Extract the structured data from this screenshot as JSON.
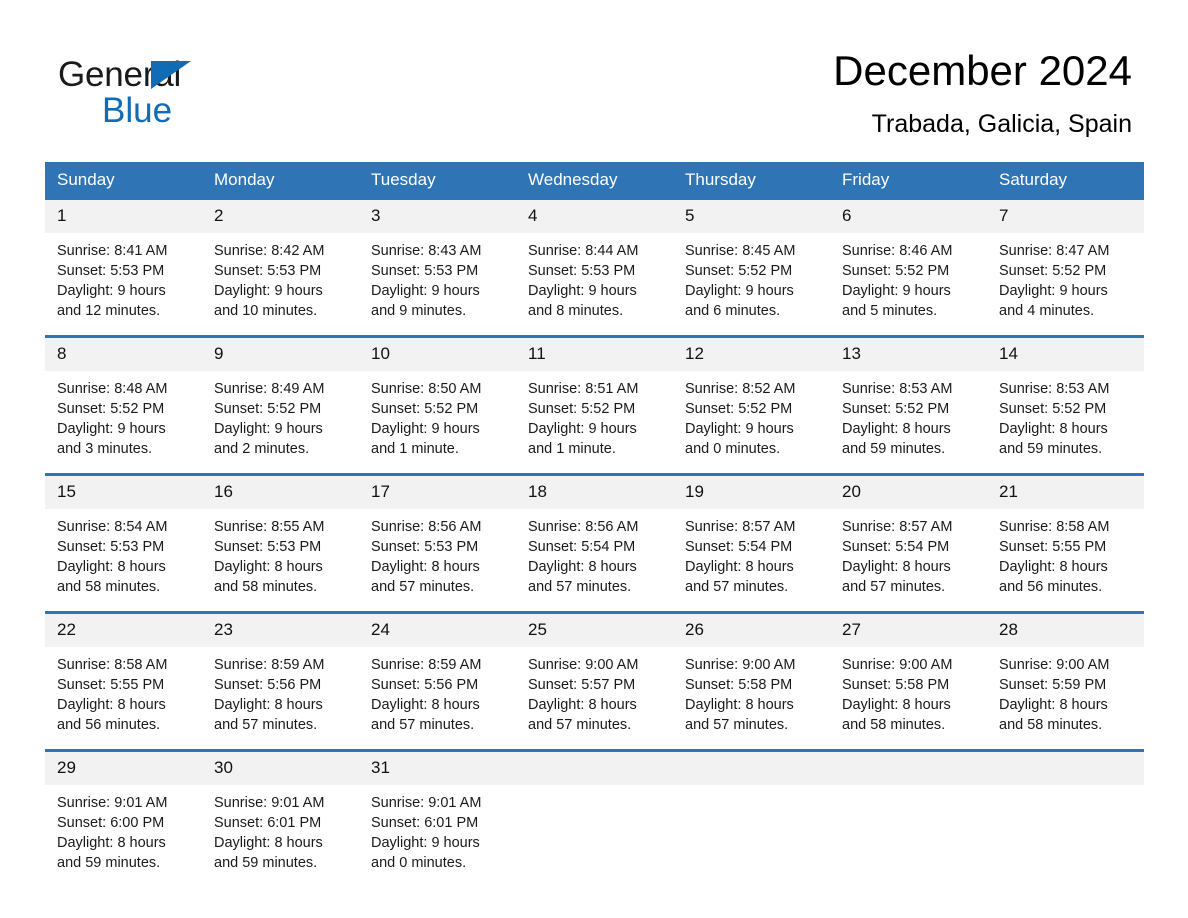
{
  "brand": {
    "name_part1": "General",
    "name_part2": "Blue",
    "accent_color": "#0f6cb5",
    "triangle_icon": "triangle-icon"
  },
  "header": {
    "month_title": "December 2024",
    "location": "Trabada, Galicia, Spain"
  },
  "theme": {
    "header_blue": "#2f75b5",
    "daynum_band": "#f2f2f2",
    "text": "#1a1a1a"
  },
  "calendar": {
    "weekday_headers": [
      "Sunday",
      "Monday",
      "Tuesday",
      "Wednesday",
      "Thursday",
      "Friday",
      "Saturday"
    ],
    "weeks": [
      {
        "days": [
          {
            "num": "1",
            "sunrise": "Sunrise: 8:41 AM",
            "sunset": "Sunset: 5:53 PM",
            "daylight1": "Daylight: 9 hours",
            "daylight2": "and 12 minutes."
          },
          {
            "num": "2",
            "sunrise": "Sunrise: 8:42 AM",
            "sunset": "Sunset: 5:53 PM",
            "daylight1": "Daylight: 9 hours",
            "daylight2": "and 10 minutes."
          },
          {
            "num": "3",
            "sunrise": "Sunrise: 8:43 AM",
            "sunset": "Sunset: 5:53 PM",
            "daylight1": "Daylight: 9 hours",
            "daylight2": "and 9 minutes."
          },
          {
            "num": "4",
            "sunrise": "Sunrise: 8:44 AM",
            "sunset": "Sunset: 5:53 PM",
            "daylight1": "Daylight: 9 hours",
            "daylight2": "and 8 minutes."
          },
          {
            "num": "5",
            "sunrise": "Sunrise: 8:45 AM",
            "sunset": "Sunset: 5:52 PM",
            "daylight1": "Daylight: 9 hours",
            "daylight2": "and 6 minutes."
          },
          {
            "num": "6",
            "sunrise": "Sunrise: 8:46 AM",
            "sunset": "Sunset: 5:52 PM",
            "daylight1": "Daylight: 9 hours",
            "daylight2": "and 5 minutes."
          },
          {
            "num": "7",
            "sunrise": "Sunrise: 8:47 AM",
            "sunset": "Sunset: 5:52 PM",
            "daylight1": "Daylight: 9 hours",
            "daylight2": "and 4 minutes."
          }
        ]
      },
      {
        "days": [
          {
            "num": "8",
            "sunrise": "Sunrise: 8:48 AM",
            "sunset": "Sunset: 5:52 PM",
            "daylight1": "Daylight: 9 hours",
            "daylight2": "and 3 minutes."
          },
          {
            "num": "9",
            "sunrise": "Sunrise: 8:49 AM",
            "sunset": "Sunset: 5:52 PM",
            "daylight1": "Daylight: 9 hours",
            "daylight2": "and 2 minutes."
          },
          {
            "num": "10",
            "sunrise": "Sunrise: 8:50 AM",
            "sunset": "Sunset: 5:52 PM",
            "daylight1": "Daylight: 9 hours",
            "daylight2": "and 1 minute."
          },
          {
            "num": "11",
            "sunrise": "Sunrise: 8:51 AM",
            "sunset": "Sunset: 5:52 PM",
            "daylight1": "Daylight: 9 hours",
            "daylight2": "and 1 minute."
          },
          {
            "num": "12",
            "sunrise": "Sunrise: 8:52 AM",
            "sunset": "Sunset: 5:52 PM",
            "daylight1": "Daylight: 9 hours",
            "daylight2": "and 0 minutes."
          },
          {
            "num": "13",
            "sunrise": "Sunrise: 8:53 AM",
            "sunset": "Sunset: 5:52 PM",
            "daylight1": "Daylight: 8 hours",
            "daylight2": "and 59 minutes."
          },
          {
            "num": "14",
            "sunrise": "Sunrise: 8:53 AM",
            "sunset": "Sunset: 5:52 PM",
            "daylight1": "Daylight: 8 hours",
            "daylight2": "and 59 minutes."
          }
        ]
      },
      {
        "days": [
          {
            "num": "15",
            "sunrise": "Sunrise: 8:54 AM",
            "sunset": "Sunset: 5:53 PM",
            "daylight1": "Daylight: 8 hours",
            "daylight2": "and 58 minutes."
          },
          {
            "num": "16",
            "sunrise": "Sunrise: 8:55 AM",
            "sunset": "Sunset: 5:53 PM",
            "daylight1": "Daylight: 8 hours",
            "daylight2": "and 58 minutes."
          },
          {
            "num": "17",
            "sunrise": "Sunrise: 8:56 AM",
            "sunset": "Sunset: 5:53 PM",
            "daylight1": "Daylight: 8 hours",
            "daylight2": "and 57 minutes."
          },
          {
            "num": "18",
            "sunrise": "Sunrise: 8:56 AM",
            "sunset": "Sunset: 5:54 PM",
            "daylight1": "Daylight: 8 hours",
            "daylight2": "and 57 minutes."
          },
          {
            "num": "19",
            "sunrise": "Sunrise: 8:57 AM",
            "sunset": "Sunset: 5:54 PM",
            "daylight1": "Daylight: 8 hours",
            "daylight2": "and 57 minutes."
          },
          {
            "num": "20",
            "sunrise": "Sunrise: 8:57 AM",
            "sunset": "Sunset: 5:54 PM",
            "daylight1": "Daylight: 8 hours",
            "daylight2": "and 57 minutes."
          },
          {
            "num": "21",
            "sunrise": "Sunrise: 8:58 AM",
            "sunset": "Sunset: 5:55 PM",
            "daylight1": "Daylight: 8 hours",
            "daylight2": "and 56 minutes."
          }
        ]
      },
      {
        "days": [
          {
            "num": "22",
            "sunrise": "Sunrise: 8:58 AM",
            "sunset": "Sunset: 5:55 PM",
            "daylight1": "Daylight: 8 hours",
            "daylight2": "and 56 minutes."
          },
          {
            "num": "23",
            "sunrise": "Sunrise: 8:59 AM",
            "sunset": "Sunset: 5:56 PM",
            "daylight1": "Daylight: 8 hours",
            "daylight2": "and 57 minutes."
          },
          {
            "num": "24",
            "sunrise": "Sunrise: 8:59 AM",
            "sunset": "Sunset: 5:56 PM",
            "daylight1": "Daylight: 8 hours",
            "daylight2": "and 57 minutes."
          },
          {
            "num": "25",
            "sunrise": "Sunrise: 9:00 AM",
            "sunset": "Sunset: 5:57 PM",
            "daylight1": "Daylight: 8 hours",
            "daylight2": "and 57 minutes."
          },
          {
            "num": "26",
            "sunrise": "Sunrise: 9:00 AM",
            "sunset": "Sunset: 5:58 PM",
            "daylight1": "Daylight: 8 hours",
            "daylight2": "and 57 minutes."
          },
          {
            "num": "27",
            "sunrise": "Sunrise: 9:00 AM",
            "sunset": "Sunset: 5:58 PM",
            "daylight1": "Daylight: 8 hours",
            "daylight2": "and 58 minutes."
          },
          {
            "num": "28",
            "sunrise": "Sunrise: 9:00 AM",
            "sunset": "Sunset: 5:59 PM",
            "daylight1": "Daylight: 8 hours",
            "daylight2": "and 58 minutes."
          }
        ]
      },
      {
        "days": [
          {
            "num": "29",
            "sunrise": "Sunrise: 9:01 AM",
            "sunset": "Sunset: 6:00 PM",
            "daylight1": "Daylight: 8 hours",
            "daylight2": "and 59 minutes."
          },
          {
            "num": "30",
            "sunrise": "Sunrise: 9:01 AM",
            "sunset": "Sunset: 6:01 PM",
            "daylight1": "Daylight: 8 hours",
            "daylight2": "and 59 minutes."
          },
          {
            "num": "31",
            "sunrise": "Sunrise: 9:01 AM",
            "sunset": "Sunset: 6:01 PM",
            "daylight1": "Daylight: 9 hours",
            "daylight2": "and 0 minutes."
          },
          {
            "num": "",
            "sunrise": "",
            "sunset": "",
            "daylight1": "",
            "daylight2": ""
          },
          {
            "num": "",
            "sunrise": "",
            "sunset": "",
            "daylight1": "",
            "daylight2": ""
          },
          {
            "num": "",
            "sunrise": "",
            "sunset": "",
            "daylight1": "",
            "daylight2": ""
          },
          {
            "num": "",
            "sunrise": "",
            "sunset": "",
            "daylight1": "",
            "daylight2": ""
          }
        ]
      }
    ]
  }
}
